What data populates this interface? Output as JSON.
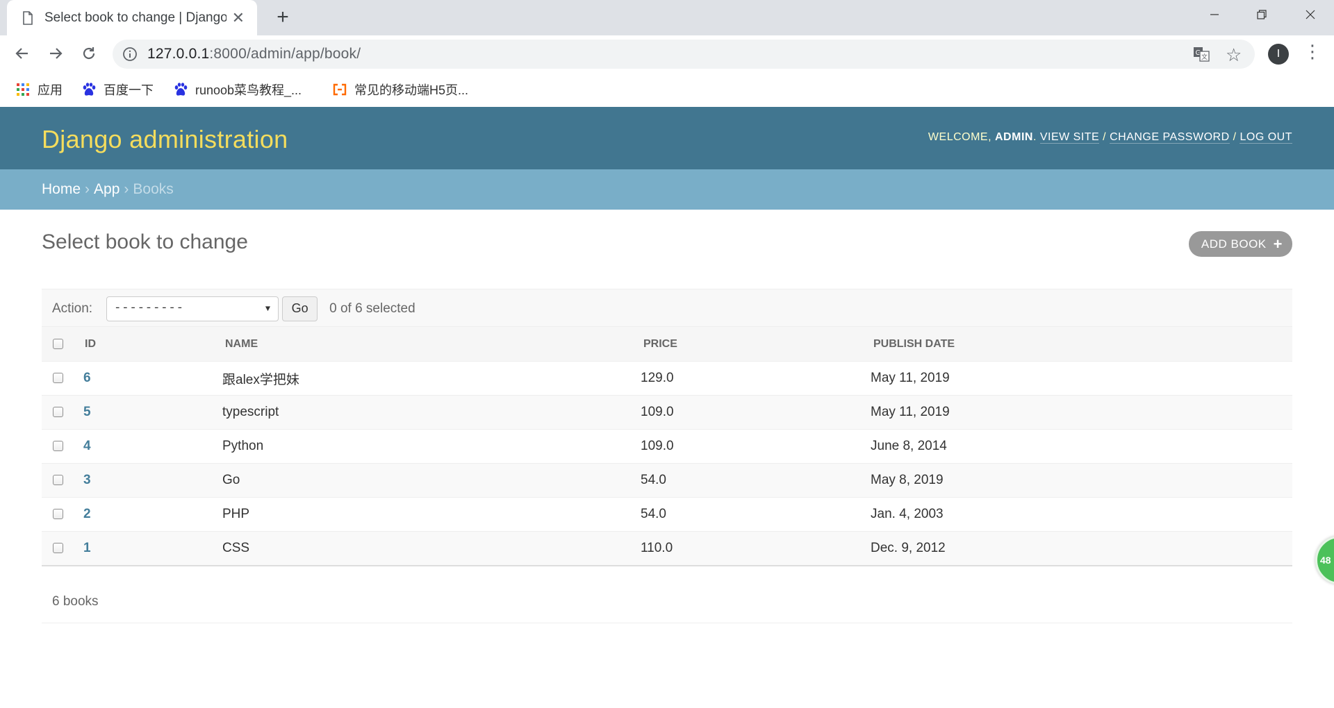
{
  "browser": {
    "tab_title": "Select book to change | Django",
    "url_host": "127.0.0.1",
    "url_path": ":8000/admin/app/book/",
    "profile_initial": "I",
    "bookmarks": [
      {
        "label": "应用",
        "icon": "apps-grid-icon"
      },
      {
        "label": "百度一下",
        "icon": "baidu-paw-icon"
      },
      {
        "label": "runoob菜鸟教程_...",
        "icon": "baidu-paw-icon"
      },
      {
        "label": "常见的移动端H5页...",
        "icon": "orange-bracket-icon"
      }
    ]
  },
  "header": {
    "branding": "Django administration",
    "welcome": "Welcome,",
    "username": "admin",
    "view_site": "View site",
    "change_password": "Change password",
    "log_out": "Log out"
  },
  "breadcrumbs": {
    "home": "Home",
    "app": "App",
    "current": "Books",
    "separator": "›"
  },
  "content": {
    "title": "Select book to change",
    "add_button": "Add book"
  },
  "actions": {
    "label": "Action:",
    "selected_option": "---------",
    "go_label": "Go",
    "counter": "0 of 6 selected"
  },
  "table": {
    "columns": [
      "ID",
      "Name",
      "Price",
      "Publish date"
    ],
    "rows": [
      {
        "id": "6",
        "name": "跟alex学把妹",
        "price": "129.0",
        "publish_date": "May 11, 2019"
      },
      {
        "id": "5",
        "name": "typescript",
        "price": "109.0",
        "publish_date": "May 11, 2019"
      },
      {
        "id": "4",
        "name": "Python",
        "price": "109.0",
        "publish_date": "June 8, 2014"
      },
      {
        "id": "3",
        "name": "Go",
        "price": "54.0",
        "publish_date": "May 8, 2019"
      },
      {
        "id": "2",
        "name": "PHP",
        "price": "54.0",
        "publish_date": "Jan. 4, 2003"
      },
      {
        "id": "1",
        "name": "CSS",
        "price": "110.0",
        "publish_date": "Dec. 9, 2012"
      }
    ]
  },
  "paginator": {
    "count_text": "6 books"
  },
  "floater": {
    "badge": "48"
  },
  "colors": {
    "header_bg": "#417690",
    "branding": "#f5dd5d",
    "breadcrumbs_bg": "#79aec8",
    "link": "#447e9b",
    "add_button_bg": "#999999",
    "floater_bg": "#4cc15a"
  }
}
